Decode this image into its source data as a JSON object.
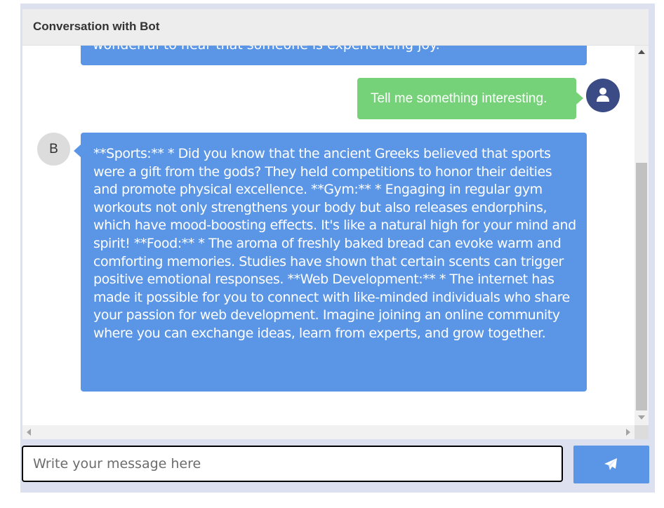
{
  "header": {
    "title": "Conversation with Bot"
  },
  "messages": [
    {
      "sender": "bot",
      "text": "wonderful to hear that someone is experiencing joy."
    },
    {
      "sender": "user",
      "text": "Tell me something interesting.",
      "avatar_icon": "user-icon"
    },
    {
      "sender": "bot",
      "avatar_letter": "B",
      "text": "**Sports:** * Did you know that the ancient Greeks believed that sports were a gift from the gods? They held competitions to honor their deities and promote physical excellence. **Gym:** * Engaging in regular gym workouts not only strengthens your body but also releases endorphins, which have mood-boosting effects. It's like a natural high for your mind and spirit! **Food:** * The aroma of freshly baked bread can evoke warm and comforting memories. Studies have shown that certain scents can trigger positive emotional responses. **Web Development:** * The internet has made it possible for you to connect with like-minded individuals who share your passion for web development. Imagine joining an online community where you can exchange ideas, learn from experts, and grow together."
    }
  ],
  "composer": {
    "placeholder": "Write your message here",
    "value": "",
    "send_icon": "paper-plane-icon"
  },
  "colors": {
    "bot_bubble": "#5a95e6",
    "user_bubble": "#75d278",
    "user_avatar": "#3b4b85",
    "bot_avatar": "#dcdcdc",
    "send_button": "#5a95e6",
    "header_bg": "#ededed",
    "frame_bg": "#dde0ef"
  }
}
